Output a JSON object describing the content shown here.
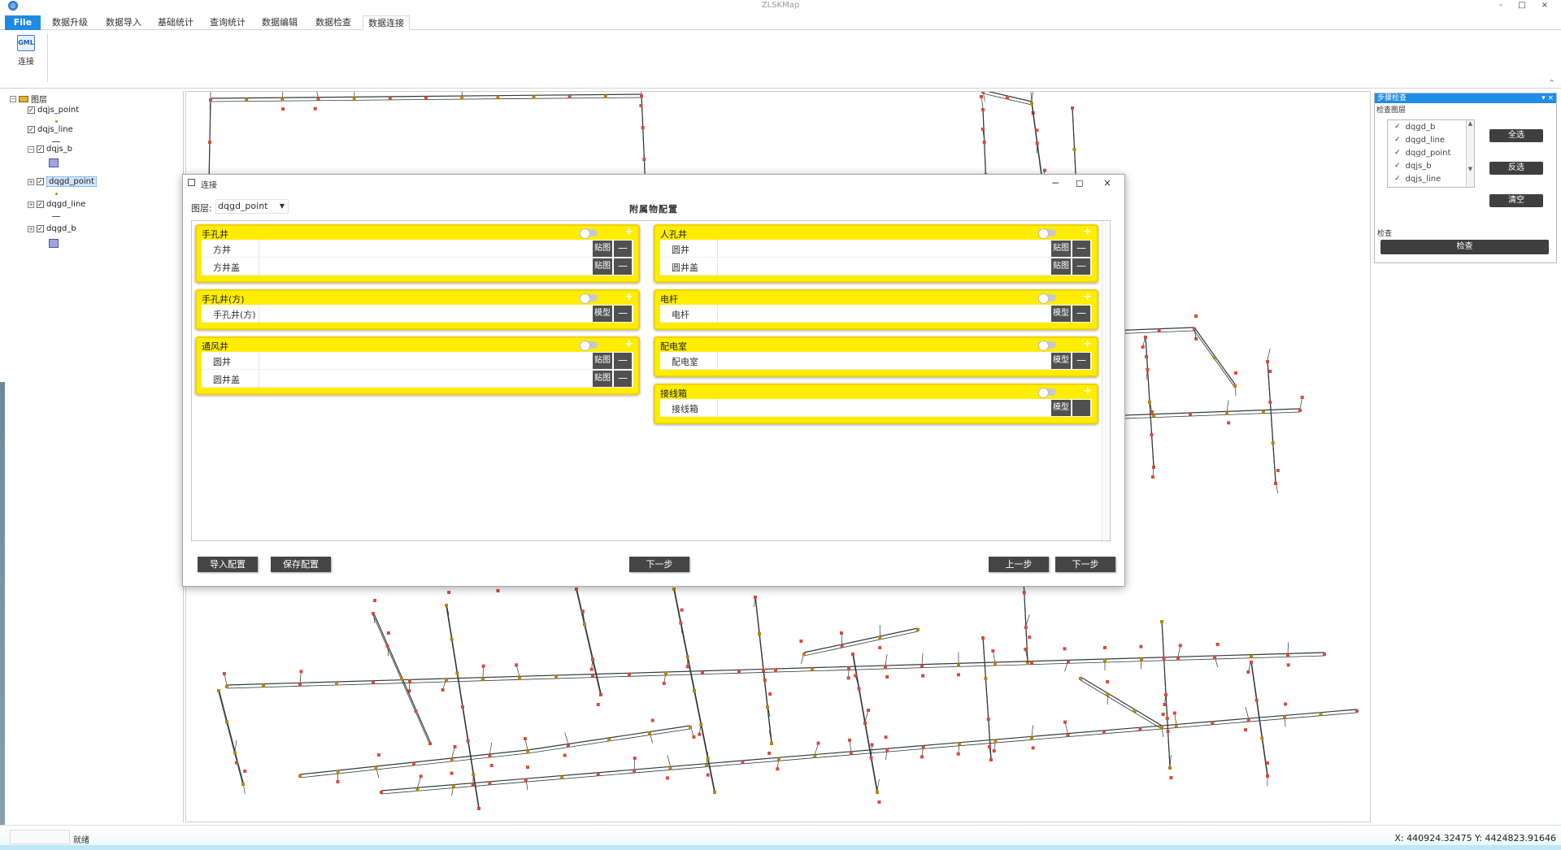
{
  "window": {
    "title": "ZLSKMap",
    "minimize": "-",
    "maximize": "□",
    "close": "×"
  },
  "ribbon": {
    "tabs": [
      "File",
      "数据升级",
      "数据导入",
      "基础统计",
      "查询统计",
      "数据编辑",
      "数据检查",
      "数据连接"
    ],
    "active_tab": "数据连接",
    "buttons": [
      {
        "icon_text": "GML",
        "label": "连接"
      }
    ],
    "collapse": "^"
  },
  "layers": {
    "root_label": "图层",
    "items": [
      {
        "label": "dqjs_point",
        "checked": true,
        "legend": "point"
      },
      {
        "label": "dqjs_line",
        "checked": true,
        "legend": "line"
      },
      {
        "label": "dqjs_b",
        "checked": true,
        "legend": "box"
      },
      {
        "label": "dqgd_point",
        "checked": true,
        "legend": "point",
        "selected": true
      },
      {
        "label": "dqgd_line",
        "checked": true,
        "legend": "line"
      },
      {
        "label": "dqgd_b",
        "checked": true,
        "legend": "box"
      }
    ]
  },
  "right_panel": {
    "title": "步骤检查",
    "controls": "▾ ×",
    "list_label": "检查图层",
    "list": [
      "dqgd_b",
      "dqgd_line",
      "dqgd_point",
      "dqjs_b",
      "dqjs_line",
      "dqjs_point"
    ],
    "buttons": [
      "全选",
      "反选",
      "清空"
    ],
    "check_label": "检查",
    "check_button": "检查"
  },
  "status": {
    "text": "就绪",
    "coords": "X: 440924.32475 Y: 4424823.91646"
  },
  "dialog": {
    "title": "连接",
    "layer_label": "图层:",
    "layer_value": "dqgd_point",
    "heading": "附属物配置",
    "cards": [
      {
        "title": "手孔井",
        "rows": [
          {
            "label": "方井",
            "btn": "贴图"
          },
          {
            "label": "方井盖",
            "btn": "贴图"
          }
        ]
      },
      {
        "title": "人孔井",
        "rows": [
          {
            "label": "圆井",
            "btn": "贴图"
          },
          {
            "label": "圆井盖",
            "btn": "贴图"
          }
        ]
      },
      {
        "title": "手孔井(方)",
        "rows": [
          {
            "label": "手孔井(方)",
            "btn": "模型"
          }
        ]
      },
      {
        "title": "电杆",
        "rows": [
          {
            "label": "电杆",
            "btn": "模型"
          }
        ]
      },
      {
        "title": "通风井",
        "rows": [
          {
            "label": "圆井",
            "btn": "贴图"
          },
          {
            "label": "圆井盖",
            "btn": "贴图"
          }
        ]
      },
      {
        "title": "配电室",
        "rows": [
          {
            "label": "配电室",
            "btn": "模型"
          }
        ]
      },
      {
        "title": "接线箱",
        "rows": [
          {
            "label": "接线箱",
            "btn": "模型"
          }
        ]
      }
    ],
    "buttons": {
      "import": "导入配置",
      "save": "保存配置",
      "next_center": "下一步",
      "prev": "上一步",
      "next": "下一步"
    }
  },
  "colors": {
    "accent": "#1e8ae3",
    "card": "#ffed00",
    "dark_button": "#454545",
    "map_line": "#2f3a3a",
    "map_node": "#d84b3a",
    "map_feature": "#b8860b"
  }
}
